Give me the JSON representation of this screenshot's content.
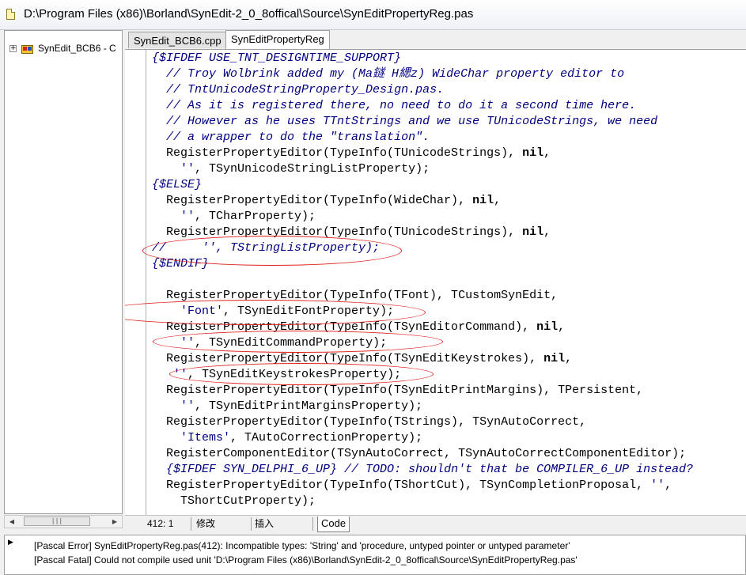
{
  "window": {
    "title": "D:\\Program Files (x86)\\Borland\\SynEdit-2_0_8offical\\Source\\SynEditPropertyReg.pas",
    "icon": "document-icon"
  },
  "project_tree": {
    "items": [
      {
        "label": "SynEdit_BCB6 - C",
        "expander": "+",
        "icon": "project-icon"
      }
    ],
    "scrollbar_thumb_grip": "|||"
  },
  "tabs": [
    {
      "label": "SynEdit_BCB6.cpp",
      "active": false
    },
    {
      "label": "SynEditPropertyReg",
      "active": true
    }
  ],
  "code_lines": [
    [
      {
        "t": "{$IFDEF USE_TNT_DESIGNTIME_SUPPORT}",
        "c": "cm"
      }
    ],
    [
      {
        "t": "  "
      },
      {
        "t": "// Troy Wolbrink added my (Ma鐩 H緦z) WideChar property editor to",
        "c": "cm"
      }
    ],
    [
      {
        "t": "  "
      },
      {
        "t": "// TntUnicodeStringProperty_Design.pas.",
        "c": "cm"
      }
    ],
    [
      {
        "t": "  "
      },
      {
        "t": "// As it is registered there, no need to do it a second time here.",
        "c": "cm"
      }
    ],
    [
      {
        "t": "  "
      },
      {
        "t": "// However as he uses TTntStrings and we use TUnicodeStrings, we need",
        "c": "cm"
      }
    ],
    [
      {
        "t": "  "
      },
      {
        "t": "// a wrapper to do the \"translation\".",
        "c": "cm"
      }
    ],
    [
      {
        "t": "  RegisterPropertyEditor(TypeInfo(TUnicodeStrings), "
      },
      {
        "t": "nil",
        "c": "kw"
      },
      {
        "t": ","
      }
    ],
    [
      {
        "t": "    "
      },
      {
        "t": "''",
        "c": "st"
      },
      {
        "t": ", TSynUnicodeStringListProperty);"
      }
    ],
    [
      {
        "t": "{$ELSE}",
        "c": "cm"
      }
    ],
    [
      {
        "t": "  RegisterPropertyEditor(TypeInfo(WideChar), "
      },
      {
        "t": "nil",
        "c": "kw"
      },
      {
        "t": ","
      }
    ],
    [
      {
        "t": "    "
      },
      {
        "t": "''",
        "c": "st"
      },
      {
        "t": ", TCharProperty);"
      }
    ],
    [
      {
        "t": "  RegisterPropertyEditor(TypeInfo(TUnicodeStrings), "
      },
      {
        "t": "nil",
        "c": "kw"
      },
      {
        "t": ","
      }
    ],
    [
      {
        "t": "//     '', TStringListProperty);",
        "c": "cm"
      }
    ],
    [
      {
        "t": "{$ENDIF}",
        "c": "cm"
      }
    ],
    [
      {
        "t": ""
      }
    ],
    [
      {
        "t": "  RegisterPropertyEditor(TypeInfo(TFont), TCustomSynEdit,"
      }
    ],
    [
      {
        "t": "    "
      },
      {
        "t": "'Font'",
        "c": "st"
      },
      {
        "t": ", TSynEditFontProperty);"
      }
    ],
    [
      {
        "t": "  RegisterPropertyEditor(TypeInfo(TSynEditorCommand), "
      },
      {
        "t": "nil",
        "c": "kw"
      },
      {
        "t": ","
      }
    ],
    [
      {
        "t": "    "
      },
      {
        "t": "''",
        "c": "st"
      },
      {
        "t": ", TSynEditCommandProperty);"
      }
    ],
    [
      {
        "t": "  RegisterPropertyEditor(TypeInfo(TSynEditKeystrokes), "
      },
      {
        "t": "nil",
        "c": "kw"
      },
      {
        "t": ","
      }
    ],
    [
      {
        "t": "   "
      },
      {
        "t": "''",
        "c": "st"
      },
      {
        "t": ", TSynEditKeystrokesProperty);"
      }
    ],
    [
      {
        "t": "  RegisterPropertyEditor(TypeInfo(TSynEditPrintMargins), TPersistent,"
      }
    ],
    [
      {
        "t": "    "
      },
      {
        "t": "''",
        "c": "st"
      },
      {
        "t": ", TSynEditPrintMarginsProperty);"
      }
    ],
    [
      {
        "t": "  RegisterPropertyEditor(TypeInfo(TStrings), TSynAutoCorrect,"
      }
    ],
    [
      {
        "t": "    "
      },
      {
        "t": "'Items'",
        "c": "st"
      },
      {
        "t": ", TAutoCorrectionProperty);"
      }
    ],
    [
      {
        "t": "  RegisterComponentEditor(TSynAutoCorrect, TSynAutoCorrectComponentEditor);"
      }
    ],
    [
      {
        "t": "  "
      },
      {
        "t": "{$IFDEF SYN_DELPHI_6_UP} // TODO: shouldn't that be COMPILER_6_UP instead?",
        "c": "cm"
      }
    ],
    [
      {
        "t": "  RegisterPropertyEditor(TypeInfo(TShortCut), TSynCompletionProposal, "
      },
      {
        "t": "''",
        "c": "st"
      },
      {
        "t": ","
      }
    ],
    [
      {
        "t": "    TShortCutProperty);"
      }
    ]
  ],
  "annotation_color": "#e02020",
  "status_bar": {
    "position": "412:  1",
    "modified": "修改",
    "insert_mode": "插入",
    "view_tab": "Code"
  },
  "messages": [
    "[Pascal Error] SynEditPropertyReg.pas(412): Incompatible types: 'String' and 'procedure, untyped pointer or untyped parameter'",
    "[Pascal Fatal] Could not compile used unit 'D:\\Program Files (x86)\\Borland\\SynEdit-2_0_8offical\\Source\\SynEditPropertyReg.pas'"
  ]
}
